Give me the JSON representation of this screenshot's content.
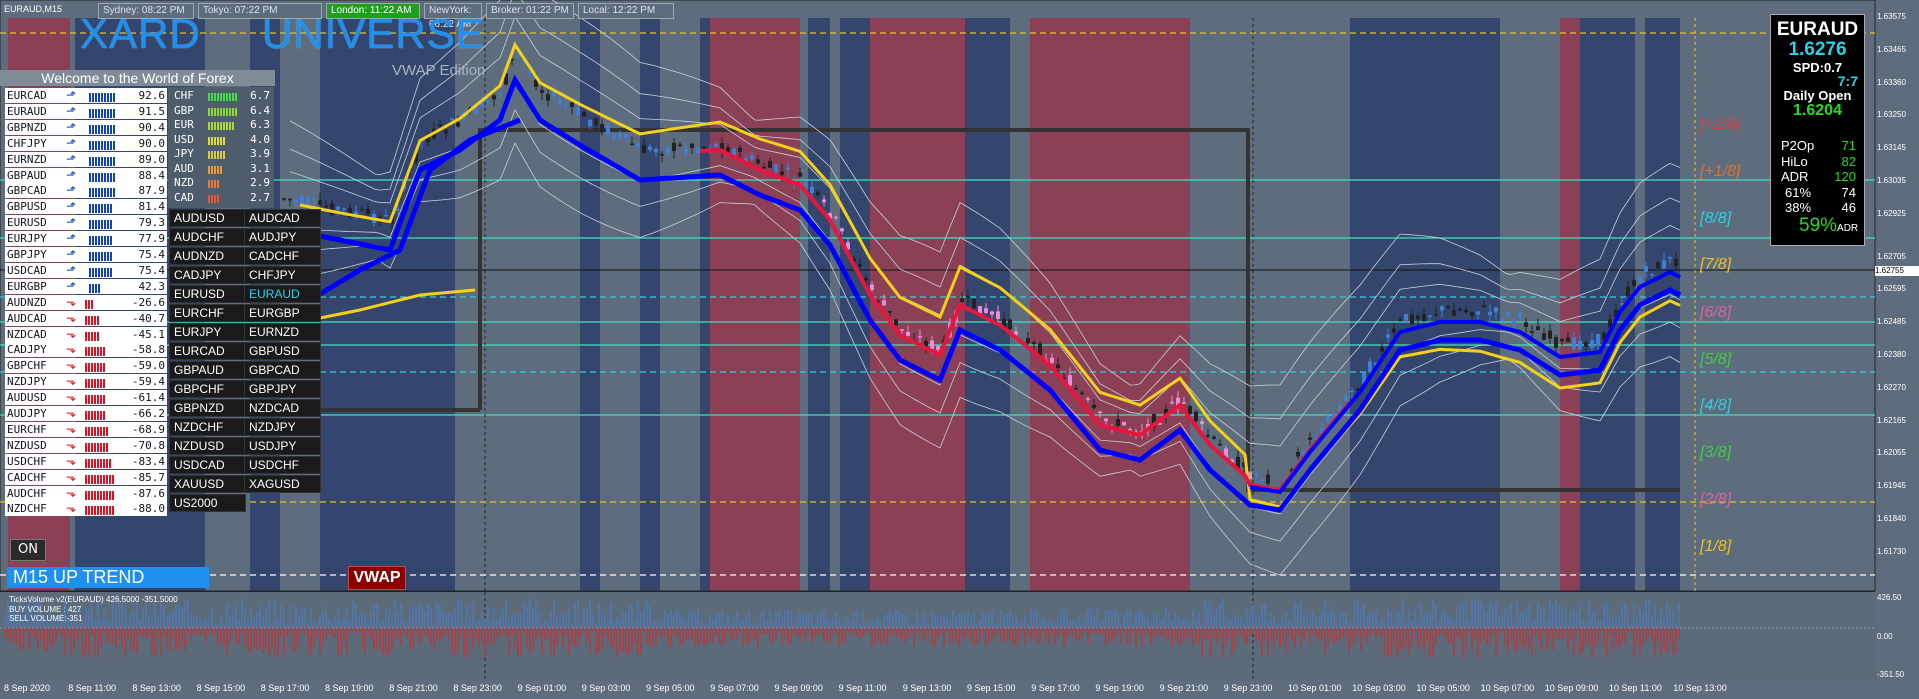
{
  "window": {
    "title": "EURAUD,M15"
  },
  "sessions": [
    {
      "label": "Sydney: 08:22 PM",
      "bg": "#5d6d7e",
      "color": "#dbe3ea"
    },
    {
      "label": "Tokyo: 07:22 PM",
      "bg": "#5d6d7e",
      "color": "#dbe3ea"
    },
    {
      "label": "London: 11:22 AM",
      "bg": "#1ea01e",
      "color": "#ffffff"
    },
    {
      "label": "NewYork: 06:22 AM",
      "bg": "#5d6d7e",
      "color": "#dbe3ea"
    },
    {
      "label": "Broker: 01:22 PM",
      "bg": "#5d6d7e",
      "color": "#dbe3ea"
    },
    {
      "label": "Local: 12:22 PM",
      "bg": "#5d6d7e",
      "color": "#dbe3ea"
    }
  ],
  "logo": {
    "word1": "XARD",
    "word2": "UNIVERSE",
    "tagline": "Welcome to the World of Forex",
    "edition": "VWAP Edition"
  },
  "strength_pairs": [
    {
      "pair": "EURCAD",
      "value": "92.6",
      "dir": "up"
    },
    {
      "pair": "EURAUD",
      "value": "91.5",
      "dir": "up"
    },
    {
      "pair": "GBPNZD",
      "value": "90.4",
      "dir": "up"
    },
    {
      "pair": "CHFJPY",
      "value": "90.0",
      "dir": "up"
    },
    {
      "pair": "EURNZD",
      "value": "89.0",
      "dir": "up"
    },
    {
      "pair": "GBPAUD",
      "value": "88.4",
      "dir": "up"
    },
    {
      "pair": "GBPCAD",
      "value": "87.9",
      "dir": "up"
    },
    {
      "pair": "GBPUSD",
      "value": "81.4",
      "dir": "up"
    },
    {
      "pair": "EURUSD",
      "value": "79.3",
      "dir": "up"
    },
    {
      "pair": "EURJPY",
      "value": "77.9",
      "dir": "up"
    },
    {
      "pair": "GBPJPY",
      "value": "75.4",
      "dir": "up"
    },
    {
      "pair": "USDCAD",
      "value": "75.4",
      "dir": "up"
    },
    {
      "pair": "EURGBP",
      "value": "42.3",
      "dir": "up"
    },
    {
      "pair": "AUDNZD",
      "value": "-26.6",
      "dir": "down"
    },
    {
      "pair": "AUDCAD",
      "value": "-40.7",
      "dir": "down"
    },
    {
      "pair": "NZDCAD",
      "value": "-45.1",
      "dir": "down"
    },
    {
      "pair": "CADJPY",
      "value": "-58.8",
      "dir": "down"
    },
    {
      "pair": "GBPCHF",
      "value": "-59.0",
      "dir": "down"
    },
    {
      "pair": "NZDJPY",
      "value": "-59.4",
      "dir": "down"
    },
    {
      "pair": "AUDUSD",
      "value": "-61.4",
      "dir": "down"
    },
    {
      "pair": "AUDJPY",
      "value": "-66.2",
      "dir": "down"
    },
    {
      "pair": "EURCHF",
      "value": "-68.9",
      "dir": "down"
    },
    {
      "pair": "NZDUSD",
      "value": "-70.8",
      "dir": "down"
    },
    {
      "pair": "USDCHF",
      "value": "-83.4",
      "dir": "down"
    },
    {
      "pair": "CADCHF",
      "value": "-85.7",
      "dir": "down"
    },
    {
      "pair": "AUDCHF",
      "value": "-87.6",
      "dir": "down"
    },
    {
      "pair": "NZDCHF",
      "value": "-88.0",
      "dir": "down"
    }
  ],
  "currency_strength": [
    {
      "cur": "CHF",
      "value": "6.7",
      "color": "#44dd44"
    },
    {
      "cur": "GBP",
      "value": "6.4",
      "color": "#88dd33"
    },
    {
      "cur": "EUR",
      "value": "6.3",
      "color": "#aadd33"
    },
    {
      "cur": "USD",
      "value": "4.0",
      "color": "#dddd33"
    },
    {
      "cur": "JPY",
      "value": "3.9",
      "color": "#ddcc33"
    },
    {
      "cur": "AUD",
      "value": "3.1",
      "color": "#ee9933"
    },
    {
      "cur": "NZD",
      "value": "2.9",
      "color": "#ee7733"
    },
    {
      "cur": "CAD",
      "value": "2.7",
      "color": "#ee5533"
    }
  ],
  "pair_buttons": [
    [
      "AUDUSD",
      "AUDCAD"
    ],
    [
      "AUDCHF",
      "AUDJPY"
    ],
    [
      "AUDNZD",
      "CADCHF"
    ],
    [
      "CADJPY",
      "CHFJPY"
    ],
    [
      "EURUSD",
      "EURAUD"
    ],
    [
      "EURCHF",
      "EURGBP"
    ],
    [
      "EURJPY",
      "EURNZD"
    ],
    [
      "EURCAD",
      "GBPUSD"
    ],
    [
      "GBPAUD",
      "GBPCAD"
    ],
    [
      "GBPCHF",
      "GBPJPY"
    ],
    [
      "GBPNZD",
      "NZDCAD"
    ],
    [
      "NZDCHF",
      "NZDJPY"
    ],
    [
      "NZDUSD",
      "USDJPY"
    ],
    [
      "USDCAD",
      "USDCHF"
    ],
    [
      "XAUUSD",
      "XAGUSD"
    ],
    [
      "US2000",
      ""
    ]
  ],
  "active_pair": "EURAUD",
  "controls": {
    "on_label": "ON",
    "trend_label": "M15    UP TREND",
    "vwap_label": "VWAP"
  },
  "fib_levels": [
    {
      "label": "[+2/8]",
      "color": "#e04040"
    },
    {
      "label": "[+1/8]",
      "color": "#e07030"
    },
    {
      "label": "[8/8]",
      "color": "#30d0e0"
    },
    {
      "label": "[7/8]",
      "color": "#f0c020"
    },
    {
      "label": "[6/8]",
      "color": "#e060a0"
    },
    {
      "label": "[5/8]",
      "color": "#40d040"
    },
    {
      "label": "[4/8]",
      "color": "#30d0e0"
    },
    {
      "label": "[3/8]",
      "color": "#40d040"
    },
    {
      "label": "[2/8]",
      "color": "#e060a0"
    },
    {
      "label": "[1/8]",
      "color": "#f0c020"
    }
  ],
  "price_axis": [
    "1.63575",
    "1.63465",
    "1.63360",
    "1.63250",
    "1.63145",
    "1.63035",
    "1.62925",
    "1.62705",
    "1.62595",
    "1.62485",
    "1.62380",
    "1.62270",
    "1.62165",
    "1.62055",
    "1.61945",
    "1.61840",
    "1.61730"
  ],
  "current_price": "1.62755",
  "info_panel": {
    "symbol": "EURAUD",
    "price": "1.6276",
    "spread": "SPD:0.7",
    "time": "7:7",
    "daily_open_label": "Daily Open",
    "daily_open": "1.6204",
    "rows": [
      {
        "k": "P2Op",
        "v": "71"
      },
      {
        "k": "HiLo",
        "v": "82"
      },
      {
        "k": "ADR",
        "v": "120"
      },
      {
        "k": "61%",
        "v": "74"
      },
      {
        "k": "38%",
        "v": "46"
      }
    ],
    "adr_pct": "59%",
    "adr_suffix": "ADR"
  },
  "volume": {
    "title": "TicksVolume v2(EURAUD) 426.5000 -351.5000",
    "buy": "BUY VOLUME : 427",
    "sell": "SELL VOLUME:-351",
    "axis": [
      "426.50",
      "0.00",
      "-351.50"
    ]
  },
  "time_labels": [
    "8 Sep 2020",
    "8 Sep 11:00",
    "8 Sep 13:00",
    "8 Sep 15:00",
    "8 Sep 17:00",
    "8 Sep 19:00",
    "8 Sep 21:00",
    "8 Sep 23:00",
    "9 Sep 01:00",
    "9 Sep 03:00",
    "9 Sep 05:00",
    "9 Sep 07:00",
    "9 Sep 09:00",
    "9 Sep 11:00",
    "9 Sep 13:00",
    "9 Sep 15:00",
    "9 Sep 17:00",
    "9 Sep 19:00",
    "9 Sep 21:00",
    "9 Sep 23:00",
    "10 Sep 01:00",
    "10 Sep 03:00",
    "10 Sep 05:00",
    "10 Sep 07:00",
    "10 Sep 09:00",
    "10 Sep 11:00",
    "10 Sep 13:00"
  ],
  "colors": {
    "bull": "#3e7fd8",
    "bear": "#f08ad8",
    "vwap_blue": "#0000ff",
    "vwap_red": "#e8163c",
    "vwap_yellow": "#f5d01a"
  }
}
